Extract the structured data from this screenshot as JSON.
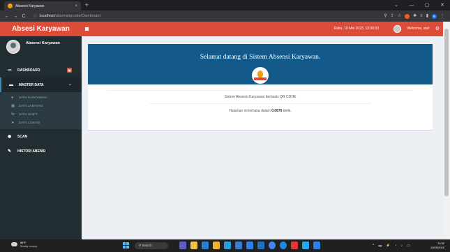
{
  "browser": {
    "tab_title": "Absensi Karyawan",
    "tab_close": "×",
    "new_tab": "+",
    "url_host": "localhost",
    "url_path": "/absensiqrcode/Dashboard",
    "back": "←",
    "forward": "→",
    "reload": "C",
    "site_info": "ⓘ",
    "minimize": "—",
    "maximize": "▢",
    "close": "✕",
    "chevron": "⌄"
  },
  "app": {
    "logo": "Absesi Karyawan",
    "datetime": "Rabu, 10 Mei 2023, 13:30:33",
    "welcome": "Welcome, staf",
    "accent": "#dd4b39",
    "sidebar_bg": "#222d32",
    "banner_bg": "#135a8b"
  },
  "sidebar": {
    "user_name": "Absensi Karyawan",
    "dashboard": {
      "icon": "dashboard-icon",
      "label": "DASHBOARD",
      "badge": "▣"
    },
    "master": {
      "icon": "folder-icon",
      "label": "MASTER DATA",
      "chevron": "⌄"
    },
    "submenu": [
      {
        "icon": "user-icon",
        "glyph": "👤",
        "label": "DATA KARYAWAN"
      },
      {
        "icon": "building-icon",
        "glyph": "▦",
        "label": "DATA JABATAN"
      },
      {
        "icon": "shift-icon",
        "glyph": "⇆",
        "label": "DATA SHIFT"
      },
      {
        "icon": "location-icon",
        "glyph": "➤",
        "label": "DATA LOKASI"
      }
    ],
    "scan": {
      "icon": "camera-icon",
      "glyph": "◉",
      "label": "SCAN"
    },
    "history": {
      "icon": "pencil-icon",
      "glyph": "✎",
      "label": "HISTORI ABENSI"
    }
  },
  "main": {
    "title": "Selamat datang di Sistem Absensi Karyawan.",
    "description": "Sistem Absensi Karyawan berbasis QR CODE",
    "render_prefix": "Halaman ini terbuka dalam",
    "render_time": "0.0970",
    "render_suffix": "detik."
  },
  "taskbar": {
    "temperature": "85°F",
    "weather": "Mostly cloudy",
    "search": "Search",
    "time": "13:30",
    "date": "10/05/2023",
    "tray": [
      "^",
      "▬",
      "⚡",
      "◔",
      "♪",
      "▭"
    ]
  }
}
